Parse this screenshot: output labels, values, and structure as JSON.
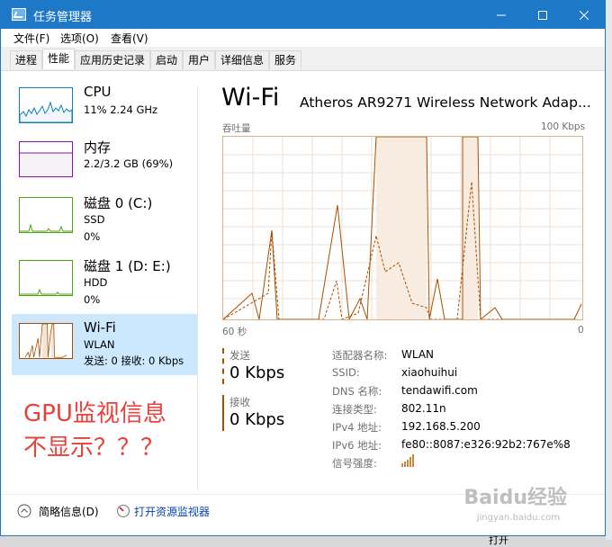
{
  "window": {
    "title": "任务管理器"
  },
  "menu": [
    "文件(F)",
    "选项(O)",
    "查看(V)"
  ],
  "tabs": [
    "进程",
    "性能",
    "应用历史记录",
    "启动",
    "用户",
    "详细信息",
    "服务"
  ],
  "active_tab": "性能",
  "sidebar": [
    {
      "name": "CPU",
      "line2": "11% 2.24 GHz",
      "line3": "",
      "color": "#117dbb"
    },
    {
      "name": "内存",
      "line2": "2.2/3.2 GB (69%)",
      "line3": "",
      "color": "#8b12ae"
    },
    {
      "name": "磁盘 0 (C:)",
      "line2": "SSD",
      "line3": "0%",
      "color": "#4da60c"
    },
    {
      "name": "磁盘 1 (D: E:)",
      "line2": "HDD",
      "line3": "0%",
      "color": "#4da60c"
    },
    {
      "name": "Wi-Fi",
      "line2": "WLAN",
      "line3": "发送: 0 接收: 0 Kbps",
      "color": "#a74f01"
    }
  ],
  "detail": {
    "title": "Wi-Fi",
    "adapter": "Atheros AR9271 Wireless Network Adap...",
    "graph_label": "吞吐量",
    "graph_max": "100 Kbps",
    "time_left": "60 秒",
    "time_right": "0",
    "send_label": "发送",
    "send_value": "0 Kbps",
    "recv_label": "接收",
    "recv_value": "0 Kbps",
    "props": [
      {
        "k": "适配器名称:",
        "v": "WLAN"
      },
      {
        "k": "SSID:",
        "v": "xiaohuihui"
      },
      {
        "k": "DNS 名称:",
        "v": "tendawifi.com"
      },
      {
        "k": "连接类型:",
        "v": "802.11n"
      },
      {
        "k": "IPv4 地址:",
        "v": "192.168.5.200"
      },
      {
        "k": "IPv6 地址:",
        "v": "fe80::8087:e326:92b2:767e%8"
      },
      {
        "k": "信号强度:",
        "v": ""
      }
    ]
  },
  "annotation": {
    "line1": "GPU监视信息",
    "line2": "不显示？？？"
  },
  "bottom": {
    "fewer_details": "简略信息(D)",
    "open_monitor": "打开资源监视器"
  },
  "background_window": {
    "button": "打开"
  },
  "watermark": {
    "brand": "Baidu经验",
    "url": "jingyan.baidu.com"
  },
  "colors": {
    "titlebar": "#1e78c8",
    "selected": "#cce8ff",
    "wifi": "#a74f01",
    "annotation": "#e8413b"
  }
}
